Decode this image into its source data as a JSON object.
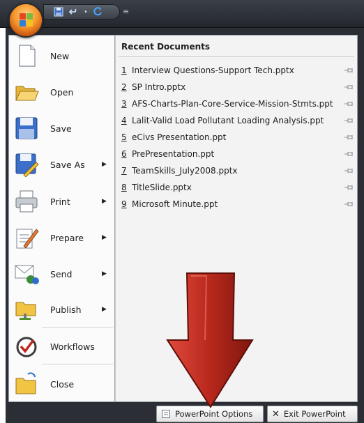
{
  "qat": {
    "customize_glyph": "≡"
  },
  "menu": {
    "items": [
      {
        "label": "New",
        "icon": "new-document-icon"
      },
      {
        "label": "Open",
        "icon": "open-folder-icon"
      },
      {
        "label": "Save",
        "icon": "save-disk-icon"
      },
      {
        "label": "Save As",
        "icon": "save-as-icon",
        "arrow": "▶"
      },
      {
        "label": "Print",
        "icon": "printer-icon",
        "arrow": "▶"
      },
      {
        "label": "Prepare",
        "icon": "prepare-icon",
        "arrow": "▶"
      },
      {
        "label": "Send",
        "icon": "send-icon",
        "arrow": "▶"
      },
      {
        "label": "Publish",
        "icon": "publish-icon",
        "arrow": "▶"
      },
      {
        "label": "Workflows",
        "icon": "workflows-icon"
      },
      {
        "label": "Close",
        "icon": "close-folder-icon"
      }
    ]
  },
  "recent": {
    "header": "Recent Documents",
    "items": [
      {
        "num": "1",
        "name": "Interview Questions-Support Tech.pptx"
      },
      {
        "num": "2",
        "name": "SP Intro.pptx"
      },
      {
        "num": "3",
        "name": "AFS-Charts-Plan-Core-Service-Mission-Stmts.ppt"
      },
      {
        "num": "4",
        "name": "Lalit-Valid Load Pollutant Loading Analysis.ppt"
      },
      {
        "num": "5",
        "name": "eCivs Presentation.ppt"
      },
      {
        "num": "6",
        "name": "PrePresentation.ppt"
      },
      {
        "num": "7",
        "name": "TeamSkills_July2008.pptx"
      },
      {
        "num": "8",
        "name": "TitleSlide.pptx"
      },
      {
        "num": "9",
        "name": "Microsoft Minute.ppt"
      }
    ]
  },
  "footer": {
    "options_label": "PowerPoint Options",
    "exit_label": "Exit PowerPoint",
    "exit_glyph": "✕"
  },
  "colors": {
    "frame": "#2b2f35",
    "arrow": "#b8281c",
    "office_orange": "#f7962a"
  }
}
